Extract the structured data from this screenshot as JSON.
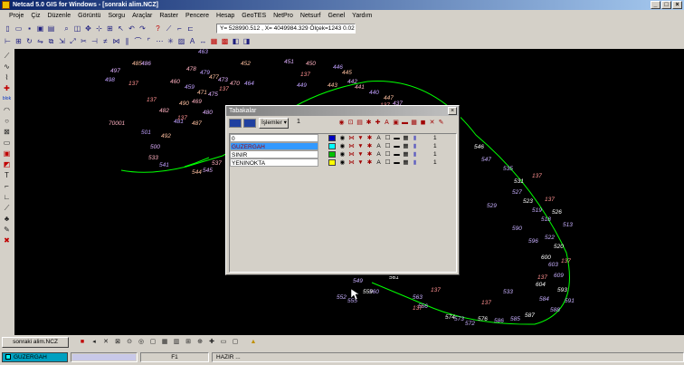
{
  "window": {
    "title": "Netcad 5.0 GIS for Windows - [sonraki alim.NCZ]",
    "controls": [
      "_",
      "□",
      "×"
    ]
  },
  "menubar": [
    "Proje",
    "Çiz",
    "Düzenle",
    "Görüntü",
    "Sorgu",
    "Araçlar",
    "Raster",
    "Pencere",
    "Hesap",
    "GeoTES",
    "NetPro",
    "Netsurf",
    "Genel",
    "Yardım"
  ],
  "toolbar": {
    "coord_text": "Y= 528990.512 , X= 4049984.329 Ölçek=1243   0.02s"
  },
  "lefttools": {
    "label_blok": "blok"
  },
  "dialog": {
    "title": "Tabakalar",
    "islemler_label": "İşlemler",
    "number_field": "1",
    "layers": [
      {
        "name": "0",
        "color": "#0000c0",
        "count": "1",
        "selected": false
      },
      {
        "name": "GUZERGAH",
        "color": "#00ffff",
        "count": "1",
        "selected": true
      },
      {
        "name": "SINIR",
        "color": "#00c000",
        "count": "1",
        "selected": false
      },
      {
        "name": "YENINOKTA",
        "color": "#ffff00",
        "count": "1",
        "selected": false
      }
    ]
  },
  "canvas": {
    "point_labels": [
      {
        "t": "463"
      },
      {
        "t": "485"
      },
      {
        "t": "486"
      },
      {
        "t": "478"
      },
      {
        "t": "479"
      },
      {
        "t": "477"
      },
      {
        "t": "473"
      },
      {
        "t": "470"
      },
      {
        "t": "464"
      },
      {
        "t": "452"
      },
      {
        "t": "451"
      },
      {
        "t": "450"
      },
      {
        "t": "446"
      },
      {
        "t": "445"
      },
      {
        "t": "497"
      },
      {
        "t": "460"
      },
      {
        "t": "459"
      },
      {
        "t": "471"
      },
      {
        "t": "475"
      },
      {
        "t": "469"
      },
      {
        "t": "449"
      },
      {
        "t": "443"
      },
      {
        "t": "442"
      },
      {
        "t": "441"
      },
      {
        "t": "440"
      },
      {
        "t": "447"
      },
      {
        "t": "437"
      },
      {
        "t": "436"
      },
      {
        "t": "498"
      },
      {
        "t": "490"
      },
      {
        "t": "480"
      },
      {
        "t": "482"
      },
      {
        "t": "481"
      },
      {
        "t": "487"
      },
      {
        "t": "438"
      },
      {
        "t": "70001"
      },
      {
        "t": "501"
      },
      {
        "t": "492"
      },
      {
        "t": "500"
      },
      {
        "t": "533"
      },
      {
        "t": "541"
      },
      {
        "t": "544"
      },
      {
        "t": "545"
      },
      {
        "t": "537"
      },
      {
        "t": "535"
      },
      {
        "t": "546"
      },
      {
        "t": "547"
      },
      {
        "t": "535"
      },
      {
        "t": "531"
      },
      {
        "t": "529"
      },
      {
        "t": "527"
      },
      {
        "t": "523"
      },
      {
        "t": "519"
      },
      {
        "t": "518"
      },
      {
        "t": "526"
      },
      {
        "t": "513"
      },
      {
        "t": "522"
      },
      {
        "t": "520"
      },
      {
        "t": "590"
      },
      {
        "t": "596"
      },
      {
        "t": "600"
      },
      {
        "t": "603"
      },
      {
        "t": "609"
      },
      {
        "t": "604"
      },
      {
        "t": "533"
      },
      {
        "t": "584"
      },
      {
        "t": "593"
      },
      {
        "t": "591"
      },
      {
        "t": "588"
      },
      {
        "t": "587"
      },
      {
        "t": "585"
      },
      {
        "t": "586"
      },
      {
        "t": "576"
      },
      {
        "t": "572"
      },
      {
        "t": "573"
      },
      {
        "t": "574"
      },
      {
        "t": "556"
      },
      {
        "t": "560"
      },
      {
        "t": "561"
      },
      {
        "t": "563"
      },
      {
        "t": "549"
      },
      {
        "t": "559"
      },
      {
        "t": "555"
      },
      {
        "t": "552"
      },
      {
        "t": "137"
      },
      {
        "t": "137"
      },
      {
        "t": "137"
      },
      {
        "t": "137"
      },
      {
        "t": "137"
      },
      {
        "t": "137"
      },
      {
        "t": "137"
      },
      {
        "t": "137"
      },
      {
        "t": "137"
      },
      {
        "t": "137"
      },
      {
        "t": "137"
      },
      {
        "t": "137"
      },
      {
        "t": "137"
      },
      {
        "t": "137"
      }
    ]
  },
  "bottombar": {
    "file_tab": "sonraki alim.NCZ"
  },
  "statusbar": {
    "layer": "GUZERGAH",
    "layer_color": "#00ffff",
    "f_key": "F1",
    "status": "HAZIR ..."
  }
}
